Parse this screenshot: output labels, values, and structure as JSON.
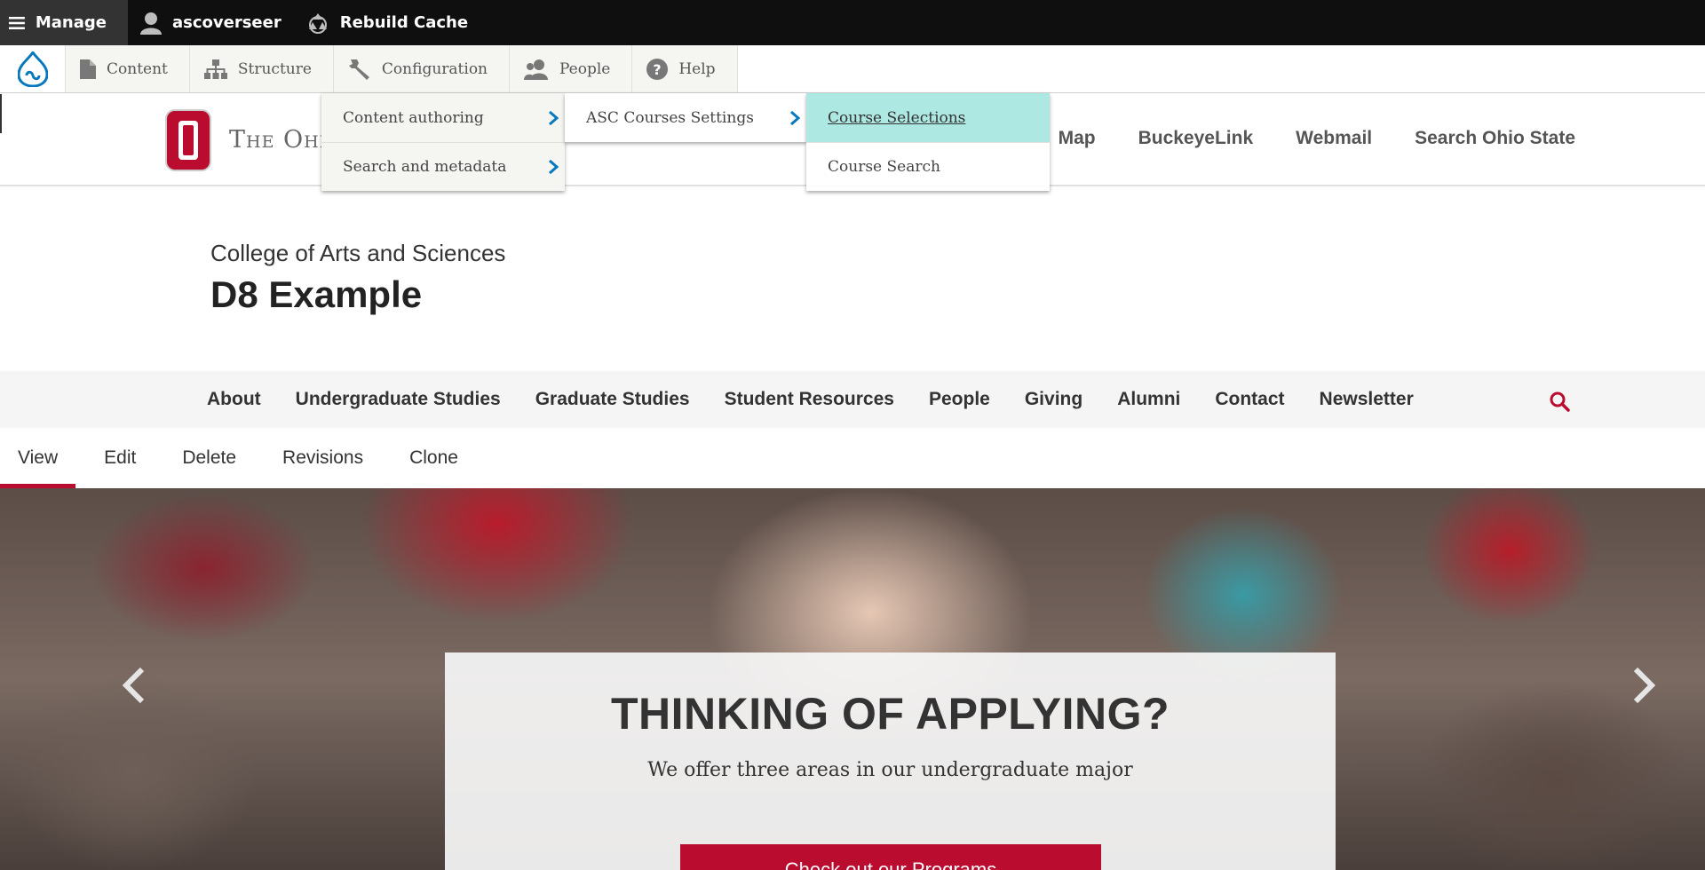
{
  "admin_bar": {
    "manage_label": "Manage",
    "user_label": "ascoverseer",
    "cache_label": "Rebuild Cache",
    "icons": [
      "hamburger-icon",
      "user-icon",
      "recycle-icon"
    ]
  },
  "tray": {
    "items": [
      {
        "label": "Content",
        "icon": "file-icon"
      },
      {
        "label": "Structure",
        "icon": "sitemap-icon"
      },
      {
        "label": "Configuration",
        "icon": "wrench-icon"
      },
      {
        "label": "People",
        "icon": "people-icon"
      },
      {
        "label": "Help",
        "icon": "help-icon"
      }
    ]
  },
  "menus": {
    "configuration": [
      "Content authoring",
      "Search and metadata"
    ],
    "content_authoring": [
      "ASC Courses Settings"
    ],
    "asc_courses": [
      "Course Selections",
      "Course Search"
    ]
  },
  "osu": {
    "name": "The Ohi",
    "links": [
      "Map",
      "BuckeyeLink",
      "Webmail",
      "Search Ohio State"
    ],
    "brand_color": "#ba0c2f"
  },
  "site": {
    "subtitle": "College of Arts and Sciences",
    "title": "D8 Example"
  },
  "main_nav": {
    "links": [
      "About",
      "Undergraduate Studies",
      "Graduate Studies",
      "Student Resources",
      "People",
      "Giving",
      "Alumni",
      "Contact",
      "Newsletter"
    ]
  },
  "tabs": [
    "View",
    "Edit",
    "Delete",
    "Revisions",
    "Clone"
  ],
  "hero": {
    "title": "THINKING OF APPLYING?",
    "text": "We offer three areas in our undergraduate major",
    "button_label": "Check out our Programs"
  }
}
